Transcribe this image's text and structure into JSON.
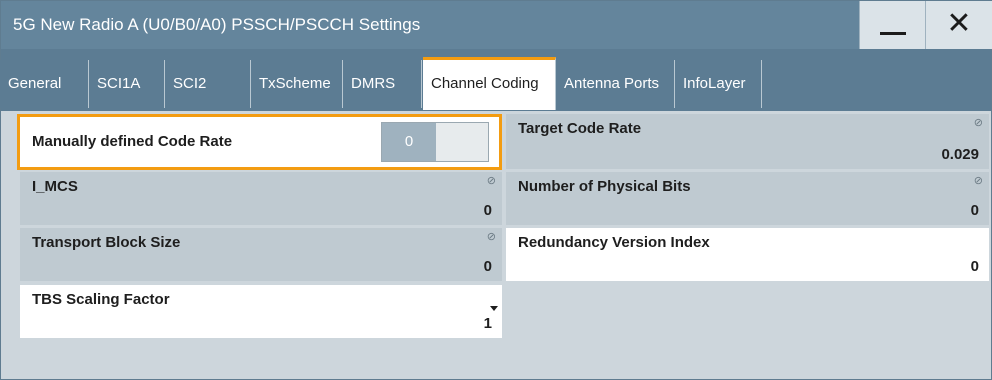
{
  "window": {
    "title": "5G New Radio A (U0/B0/A0) PSSCH/PSCCH Settings",
    "close_symbol": "✕"
  },
  "tabs": [
    {
      "label": "General"
    },
    {
      "label": "SCI1A"
    },
    {
      "label": "SCI2"
    },
    {
      "label": "TxScheme"
    },
    {
      "label": "DMRS"
    },
    {
      "label": "Channel Coding",
      "active": true
    },
    {
      "label": "Antenna Ports"
    },
    {
      "label": "InfoLayer"
    }
  ],
  "fields": {
    "manual_code_rate": {
      "label": "Manually defined Code Rate",
      "toggle_value": "0"
    },
    "target_code_rate": {
      "label": "Target Code Rate",
      "value": "0.029"
    },
    "i_mcs": {
      "label": "I_MCS",
      "value": "0"
    },
    "physical_bits": {
      "label": "Number of Physical Bits",
      "value": "0"
    },
    "transport_block_size": {
      "label": "Transport Block Size",
      "value": "0"
    },
    "redundancy_version": {
      "label": "Redundancy Version Index",
      "value": "0"
    },
    "tbs_scaling": {
      "label": "TBS Scaling Factor",
      "value": "1"
    }
  },
  "icons": {
    "lock": "⊘"
  },
  "colors": {
    "titlebar": "#64859c",
    "tabbar": "#5c7c93",
    "accent": "#f39c11",
    "panel": "#cdd6dc",
    "readonly_field": "#bfcad1"
  }
}
